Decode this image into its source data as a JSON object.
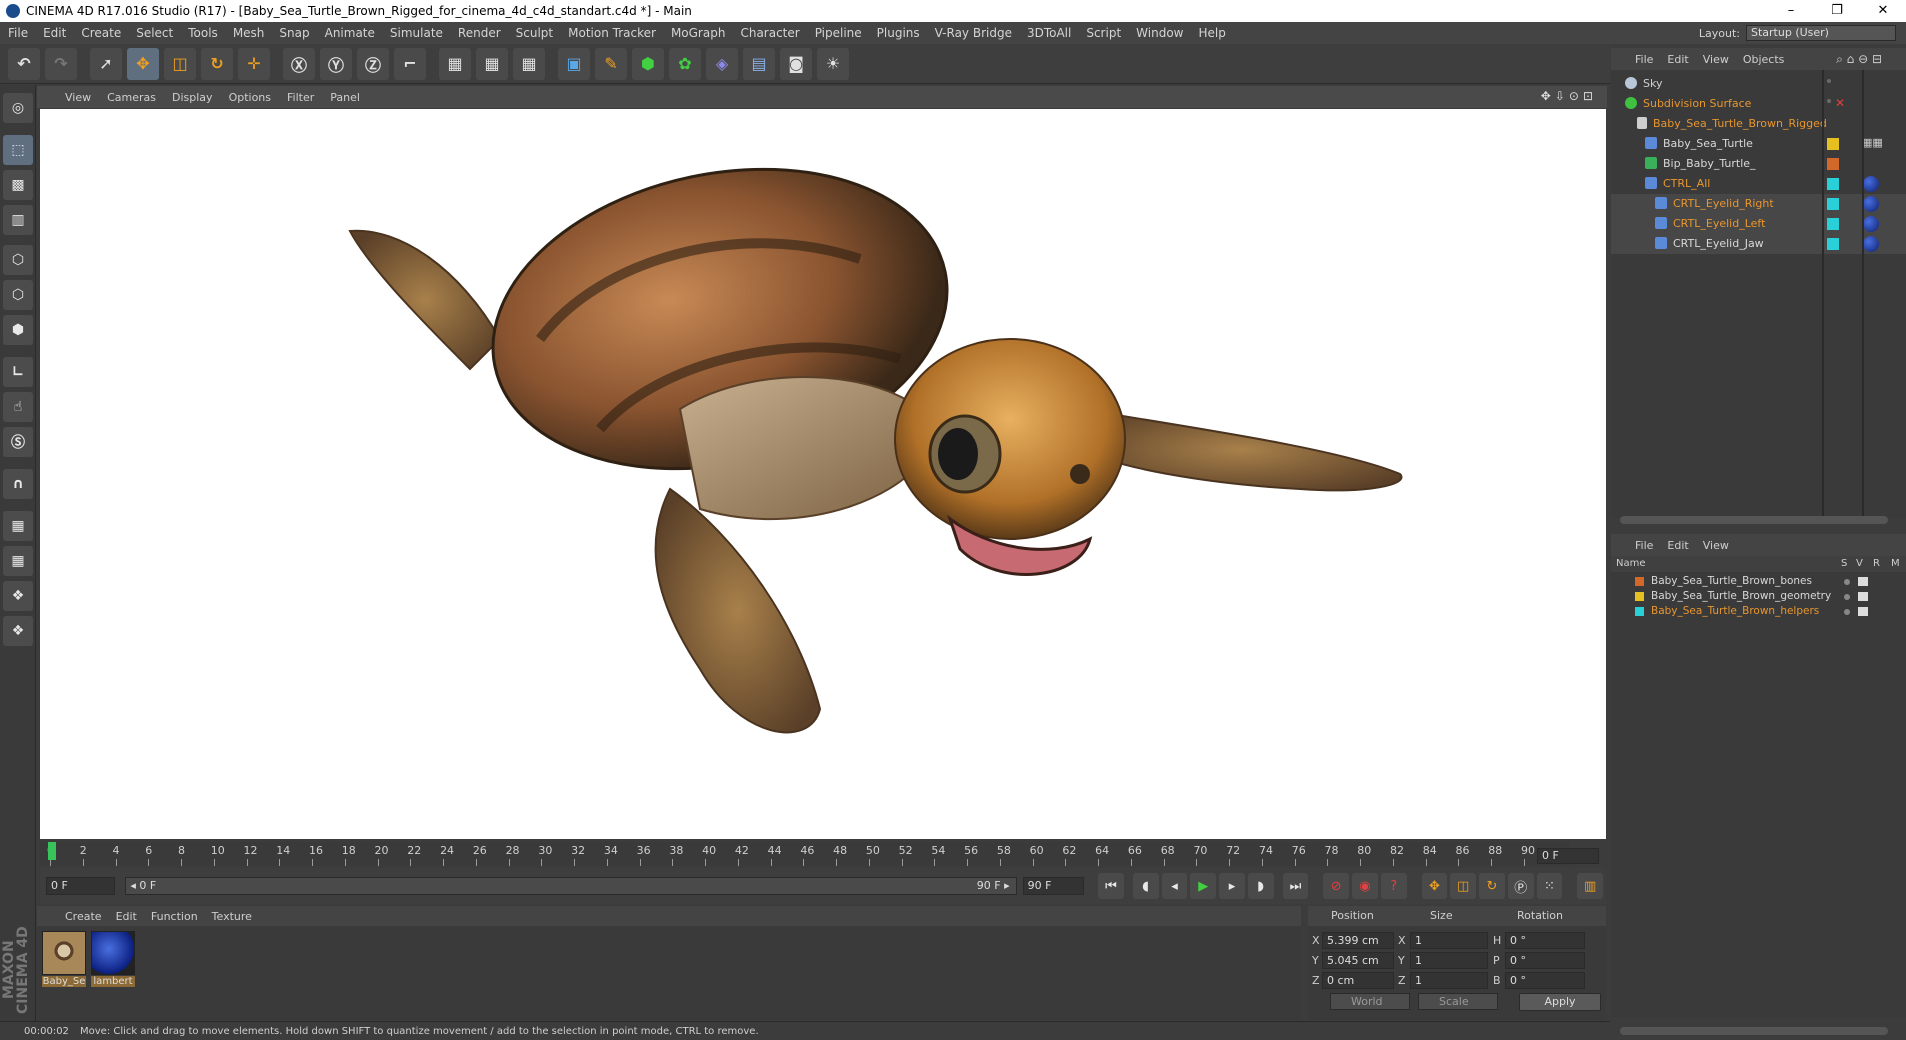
{
  "window": {
    "title": "CINEMA 4D R17.016 Studio (R17) - [Baby_Sea_Turtle_Brown_Rigged_for_cinema_4d_c4d_standart.c4d *] - Main",
    "minimize": "–",
    "restore": "❐",
    "close": "✕"
  },
  "menu": [
    "File",
    "Edit",
    "Create",
    "Select",
    "Tools",
    "Mesh",
    "Snap",
    "Animate",
    "Simulate",
    "Render",
    "Sculpt",
    "Motion Tracker",
    "MoGraph",
    "Character",
    "Pipeline",
    "Plugins",
    "V-Ray Bridge",
    "3DToAll",
    "Script",
    "Window",
    "Help"
  ],
  "layout": {
    "label": "Layout:",
    "value": "Startup (User)"
  },
  "viewport_menu": [
    "View",
    "Cameras",
    "Display",
    "Options",
    "Filter",
    "Panel"
  ],
  "viewport_icons": "✥⇩⊙⊡",
  "timeline": {
    "ticks": [
      "0",
      "2",
      "4",
      "6",
      "8",
      "10",
      "12",
      "14",
      "16",
      "18",
      "20",
      "22",
      "24",
      "26",
      "28",
      "30",
      "32",
      "34",
      "36",
      "38",
      "40",
      "42",
      "44",
      "46",
      "48",
      "50",
      "52",
      "54",
      "56",
      "58",
      "60",
      "62",
      "64",
      "66",
      "68",
      "70",
      "72",
      "74",
      "76",
      "78",
      "80",
      "82",
      "84",
      "86",
      "88",
      "90"
    ],
    "frame_end_field": "0 F",
    "current_frame": "0 F",
    "range_start": "◂ 0 F",
    "range_end": "90 F ▸",
    "max_frame": "90 F"
  },
  "material_menu": [
    "Create",
    "Edit",
    "Function",
    "Texture"
  ],
  "materials": [
    {
      "name": "Baby_Se",
      "color": "#6b5a3a"
    },
    {
      "name": "lambert",
      "color": "#1530b0"
    }
  ],
  "coordinates": {
    "headers": {
      "position": "Position",
      "size": "Size",
      "rotation": "Rotation"
    },
    "rows": [
      {
        "axis": "X",
        "pos": "5.399 cm",
        "size_axis": "X",
        "size": "1",
        "rot_axis": "H",
        "rot": "0 °"
      },
      {
        "axis": "Y",
        "pos": "5.045 cm",
        "size_axis": "Y",
        "size": "1",
        "rot_axis": "P",
        "rot": "0 °"
      },
      {
        "axis": "Z",
        "pos": "0 cm",
        "size_axis": "Z",
        "size": "1",
        "rot_axis": "B",
        "rot": "0 °"
      }
    ],
    "space": "World",
    "mode": "Scale",
    "apply": "Apply"
  },
  "status": {
    "time": "00:00:02",
    "message": "Move: Click and drag to move elements. Hold down SHIFT to quantize movement / add to the selection in point mode, CTRL to remove."
  },
  "object_menu": [
    "File",
    "Edit",
    "View",
    "Objects"
  ],
  "objects": [
    {
      "name": "Sky",
      "color": "#cfcfcf"
    },
    {
      "name": "Subdivision Surface",
      "color": "#e8962e"
    },
    {
      "name": "Baby_Sea_Turtle_Brown_Rigged",
      "color": "#e8962e"
    },
    {
      "name": "Baby_Sea_Turtle",
      "color": "#d8d8d8",
      "tag": "#e6c020"
    },
    {
      "name": "Bip_Baby_Turtle_",
      "color": "#d8d8d8",
      "tag": "#d2692a"
    },
    {
      "name": "CTRL_All",
      "color": "#e8962e",
      "tag": "#2ad0d8"
    },
    {
      "name": "CRTL_Eyelid_Right",
      "color": "#e8962e",
      "tag": "#2ad0d8"
    },
    {
      "name": "CRTL_Eyelid_Left",
      "color": "#e8962e",
      "tag": "#2ad0d8"
    },
    {
      "name": "CRTL_Eyelid_Jaw",
      "color": "#d8d8d8",
      "tag": "#2ad0d8"
    }
  ],
  "layer_menu": [
    "File",
    "Edit",
    "View"
  ],
  "layer_headers": {
    "name": "Name",
    "s": "S",
    "v": "V",
    "r": "R",
    "m": "M"
  },
  "layers": [
    {
      "name": "Baby_Sea_Turtle_Brown_bones",
      "color": "#d2692a",
      "text": "#d8d8d8"
    },
    {
      "name": "Baby_Sea_Turtle_Brown_geometry",
      "color": "#e6c020",
      "text": "#d8d8d8"
    },
    {
      "name": "Baby_Sea_Turtle_Brown_helpers",
      "color": "#2ad0d8",
      "text": "#e8962e"
    }
  ],
  "maxon": "MAXON CINEMA 4D"
}
